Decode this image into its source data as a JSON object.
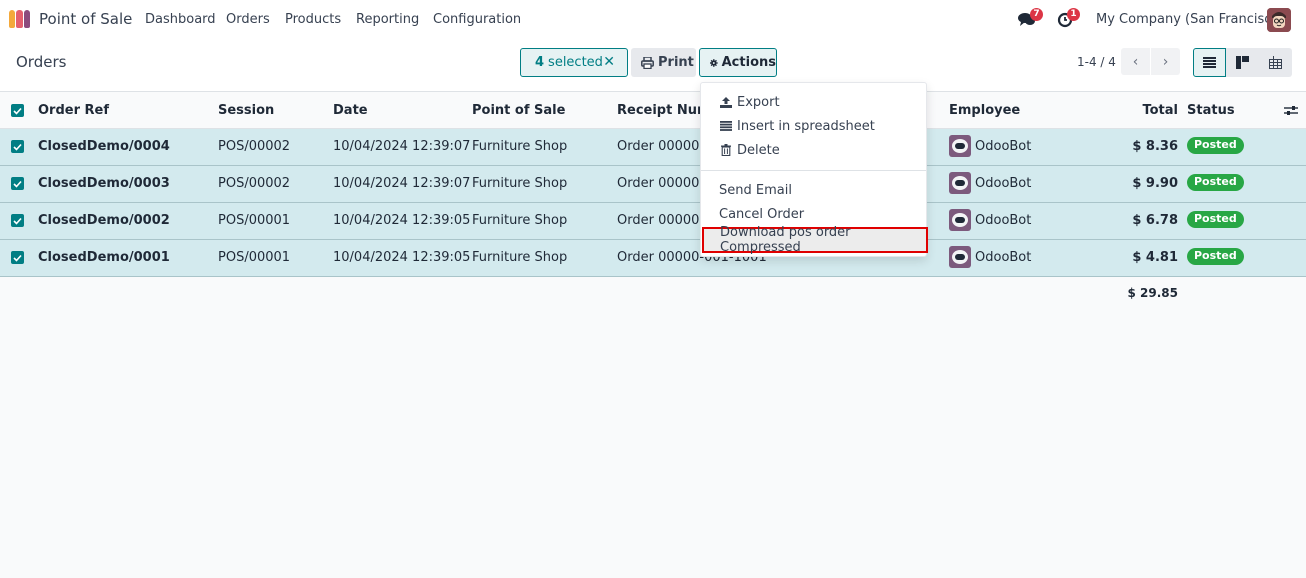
{
  "navbar": {
    "app_name": "Point of Sale",
    "menu": [
      "Dashboard",
      "Orders",
      "Products",
      "Reporting",
      "Configuration"
    ],
    "messages_count": "7",
    "activities_count": "1",
    "company": "My Company (San Francisco)",
    "logo_colors": [
      "#f4a93b",
      "#e45f6e",
      "#8c4a7d"
    ]
  },
  "control_panel": {
    "breadcrumb": "Orders",
    "selected_count": "4",
    "selected_label": "selected",
    "clear_selection": "✕",
    "print_label": "Print",
    "actions_label": "Actions",
    "pager": "1-4 / 4"
  },
  "actions_menu": {
    "items": [
      {
        "label": "Export",
        "icon": "upload-icon"
      },
      {
        "label": "Insert in spreadsheet",
        "icon": "list-icon"
      },
      {
        "label": "Delete",
        "icon": "trash-icon"
      },
      {
        "label": "Send Email"
      },
      {
        "label": "Cancel Order"
      },
      {
        "label": "Download pos order Compressed"
      }
    ]
  },
  "table": {
    "columns": [
      "Order Ref",
      "Session",
      "Date",
      "Point of Sale",
      "Receipt Numb",
      "Employee",
      "Total",
      "Status"
    ],
    "rows": [
      {
        "ref": "ClosedDemo/0004",
        "session": "POS/00002",
        "date": "10/04/2024 12:39:07",
        "pos": "Furniture Shop",
        "receipt": "Order 00000-0",
        "employee": "OdooBot",
        "total": "$ 8.36",
        "status": "Posted"
      },
      {
        "ref": "ClosedDemo/0003",
        "session": "POS/00002",
        "date": "10/04/2024 12:39:07",
        "pos": "Furniture Shop",
        "receipt": "Order 00000-0",
        "employee": "OdooBot",
        "total": "$ 9.90",
        "status": "Posted"
      },
      {
        "ref": "ClosedDemo/0002",
        "session": "POS/00001",
        "date": "10/04/2024 12:39:05",
        "pos": "Furniture Shop",
        "receipt": "Order 00000-0",
        "employee": "OdooBot",
        "total": "$ 6.78",
        "status": "Posted"
      },
      {
        "ref": "ClosedDemo/0001",
        "session": "POS/00001",
        "date": "10/04/2024 12:39:05",
        "pos": "Furniture Shop",
        "receipt": "Order 00000-001-1001",
        "employee": "OdooBot",
        "total": "$ 4.81",
        "status": "Posted"
      }
    ],
    "grand_total": "$ 29.85"
  },
  "colors": {
    "primary": "#017e84",
    "selected_row": "#d3eaee",
    "status_posted": "#28a745",
    "badge": "#dc3545",
    "highlight_border": "#e00000"
  }
}
